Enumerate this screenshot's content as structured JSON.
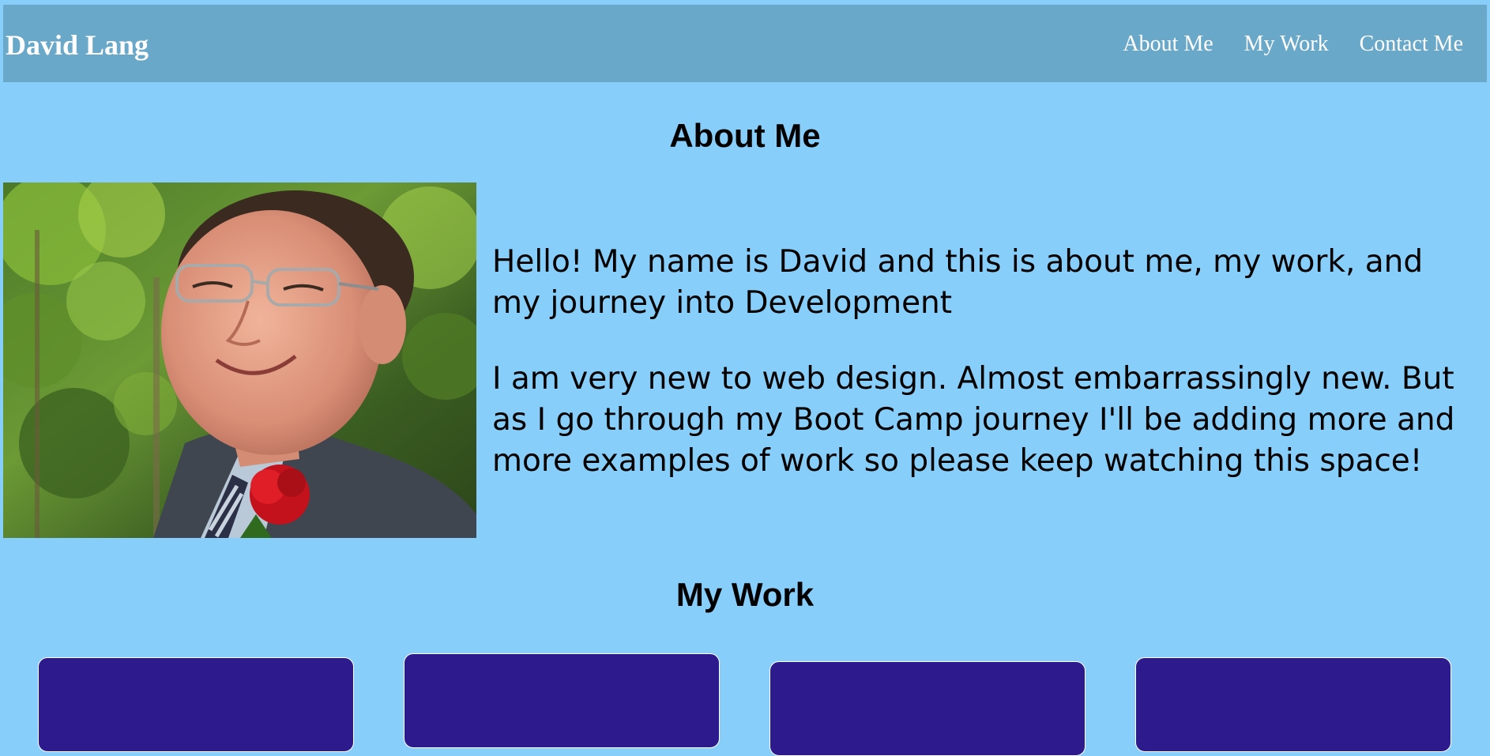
{
  "header": {
    "brand": "David Lang",
    "nav": [
      "About Me",
      "My Work",
      "Contact Me"
    ]
  },
  "about": {
    "title": "About Me",
    "paragraphs": [
      "Hello! My name is David and this is about me, my work, and my journey into Development",
      "I am very new to web design. Almost embarrassingly new. But as I go through my Boot Camp journey I'll be adding more and more examples of work so please keep watching this space!"
    ],
    "photo_icon": "profile-photo"
  },
  "work": {
    "title": "My Work",
    "card_count_visible": 4
  },
  "colors": {
    "page_background": "#87cefa",
    "header_background": "#6aa8c9",
    "card_background": "#2d1a8c",
    "nav_text": "#ffffff"
  }
}
